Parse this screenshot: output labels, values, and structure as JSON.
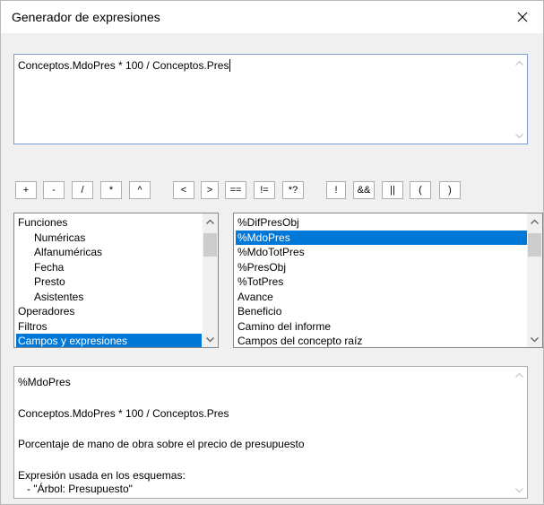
{
  "window": {
    "title": "Generador de expresiones"
  },
  "editor": {
    "expression": "Conceptos.MdoPres * 100 / Conceptos.Pres"
  },
  "operators": [
    "+",
    "-",
    "/",
    "*",
    "^",
    "<",
    ">",
    "==",
    "!=",
    "*?",
    "!",
    "&&",
    "||",
    "(",
    ")"
  ],
  "categories": {
    "items": [
      {
        "label": "Funciones",
        "indent": 0
      },
      {
        "label": "Numéricas",
        "indent": 1
      },
      {
        "label": "Alfanuméricas",
        "indent": 1
      },
      {
        "label": "Fecha",
        "indent": 1
      },
      {
        "label": "Presto",
        "indent": 1
      },
      {
        "label": "Asistentes",
        "indent": 1
      },
      {
        "label": "Operadores",
        "indent": 0
      },
      {
        "label": "Filtros",
        "indent": 0
      },
      {
        "label": "Campos y expresiones",
        "indent": 0,
        "selected": true
      }
    ]
  },
  "fields": {
    "items": [
      {
        "label": "%DifPresObj"
      },
      {
        "label": "%MdoPres",
        "selected": true
      },
      {
        "label": "%MdoTotPres"
      },
      {
        "label": "%PresObj"
      },
      {
        "label": "%TotPres"
      },
      {
        "label": "Avance"
      },
      {
        "label": "Beneficio"
      },
      {
        "label": "Camino del informe"
      },
      {
        "label": "Campos del concepto raíz"
      }
    ]
  },
  "description": {
    "name": "%MdoPres",
    "expression": "Conceptos.MdoPres * 100 / Conceptos.Pres",
    "text": "Porcentaje de mano de obra sobre el precio de presupuesto",
    "usage_title": "Expresión usada en los esquemas:",
    "usage_item": "   - \"Árbol: Presupuesto\""
  },
  "colors": {
    "selection": "#0078d7",
    "focus_border": "#7a9cd3"
  }
}
